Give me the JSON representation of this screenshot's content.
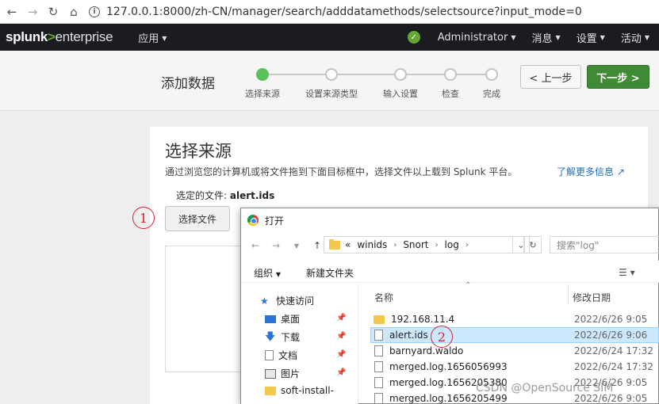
{
  "browser": {
    "url": "127.0.0.1:8000/zh-CN/manager/search/adddatamethods/selectsource?input_mode=0",
    "nav_icons": [
      "back-icon",
      "forward-icon",
      "reload-icon",
      "home-icon",
      "info-icon"
    ]
  },
  "header": {
    "logo_splunk": "splunk",
    "logo_gt": ">",
    "logo_enterprise": "enterprise",
    "app_menu": "应用",
    "user": "Administrator",
    "messages": "消息",
    "settings": "设置",
    "activity": "活动",
    "status_color": "#65a637"
  },
  "wizard": {
    "title": "添加数据",
    "steps": [
      {
        "label": "选择来源",
        "active": true
      },
      {
        "label": "设置来源类型",
        "active": false
      },
      {
        "label": "输入设置",
        "active": false
      },
      {
        "label": "检查",
        "active": false
      },
      {
        "label": "完成",
        "active": false
      }
    ],
    "prev_label": "< 上一步",
    "next_label": "下一步 >",
    "next_color": "#3e8a35"
  },
  "panel": {
    "title": "选择来源",
    "description": "通过浏览您的计算机或将文件拖到下面目标框中，选择文件以上载到 Splunk 平台。",
    "learn_more": "了解更多信息",
    "selected_prefix": "选定的文件: ",
    "selected_file": "alert.ids",
    "choose_button": "选择文件"
  },
  "annotations": [
    "1",
    "2"
  ],
  "dialog": {
    "title": "打开",
    "path": [
      "«",
      "winids",
      "Snort",
      "log"
    ],
    "search_placeholder": "搜索\"log\"",
    "toolbar": {
      "organize": "组织",
      "new_folder": "新建文件夹"
    },
    "tree": [
      {
        "label": "快速访问",
        "icon": "star-icon"
      },
      {
        "label": "桌面",
        "icon": "desktop-icon"
      },
      {
        "label": "下载",
        "icon": "download-icon"
      },
      {
        "label": "文档",
        "icon": "document-icon"
      },
      {
        "label": "图片",
        "icon": "picture-icon"
      },
      {
        "label": "soft-install-",
        "icon": "folder-icon"
      }
    ],
    "columns": {
      "name": "名称",
      "modified": "修改日期"
    },
    "files": [
      {
        "name": "192.168.11.4",
        "date": "2022/6/26 9:05",
        "type": "folder",
        "selected": false
      },
      {
        "name": "alert.ids",
        "date": "2022/6/26 9:06",
        "type": "file",
        "selected": true
      },
      {
        "name": "barnyard.waldo",
        "date": "2022/6/24 17:32",
        "type": "file",
        "selected": false
      },
      {
        "name": "merged.log.1656056993",
        "date": "2022/6/24 17:32",
        "type": "file",
        "selected": false
      },
      {
        "name": "merged.log.1656205380",
        "date": "2022/6/26 9:05",
        "type": "file",
        "selected": false
      },
      {
        "name": "merged.log.1656205499",
        "date": "2022/6/26 9:05",
        "type": "file",
        "selected": false
      }
    ]
  },
  "watermark": "CSDN @OpenSource SIM"
}
